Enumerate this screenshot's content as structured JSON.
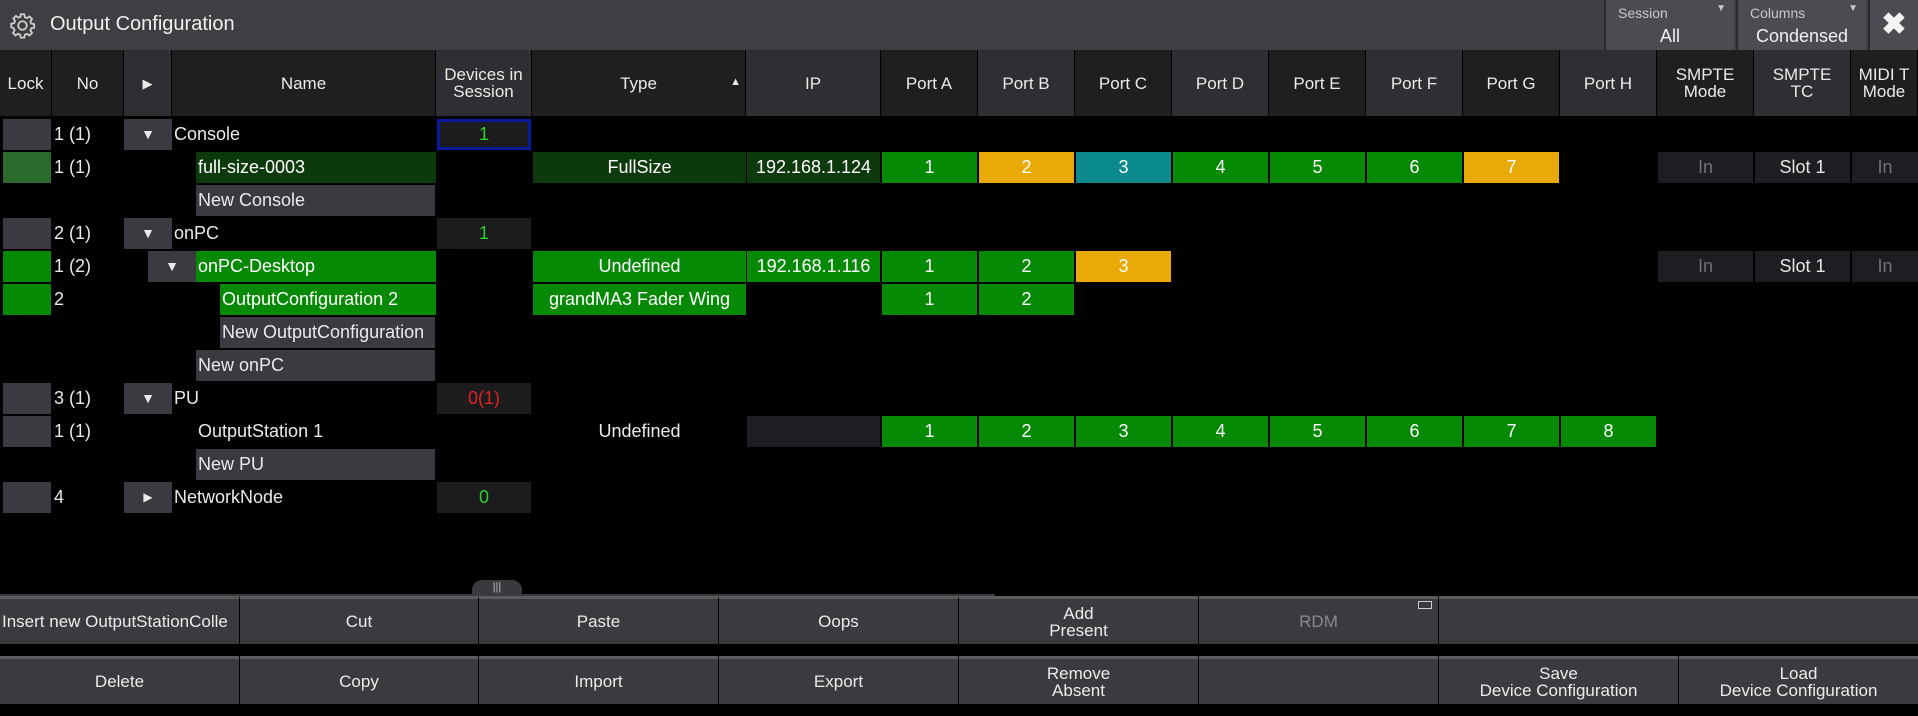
{
  "window": {
    "title": "Output Configuration"
  },
  "session": {
    "label": "Session",
    "value": "All"
  },
  "columns_dd": {
    "label": "Columns",
    "value": "Condensed"
  },
  "headers": {
    "lock": "Lock",
    "no": "No",
    "expand": "▶",
    "name": "Name",
    "devices": "Devices in\nSession",
    "type": "Type",
    "type_sort": "▲",
    "ip": "IP",
    "port_a": "Port A",
    "port_b": "Port B",
    "port_c": "Port C",
    "port_d": "Port D",
    "port_e": "Port E",
    "port_f": "Port F",
    "port_g": "Port G",
    "port_h": "Port H",
    "smpte_mode": "SMPTE\nMode",
    "smpte_tc": "SMPTE\nTC",
    "midi": "MIDI T\nMode"
  },
  "rows": {
    "r0": {
      "no": "1 (1)",
      "tri": "▼",
      "name": "Console",
      "devices": "1"
    },
    "r1": {
      "no": "1 (1)",
      "name": "full-size-0003",
      "type": "FullSize",
      "ip": "192.168.1.124",
      "ports": [
        "1",
        "2",
        "3",
        "4",
        "5",
        "6",
        "7"
      ],
      "smpte_mode": "In",
      "smpte_tc": "Slot 1",
      "midi": "In"
    },
    "r2": {
      "name": "New Console"
    },
    "r3": {
      "no": "2 (1)",
      "tri": "▼",
      "name": "onPC",
      "devices": "1"
    },
    "r4": {
      "no": "1 (2)",
      "tri": "▼",
      "name": "onPC-Desktop",
      "type": "Undefined",
      "ip": "192.168.1.116",
      "ports": [
        "1",
        "2",
        "3"
      ],
      "smpte_mode": "In",
      "smpte_tc": "Slot 1",
      "midi": "In"
    },
    "r5": {
      "no": "2",
      "name": "OutputConfiguration 2",
      "type": "grandMA3 Fader Wing",
      "ports": [
        "1",
        "2"
      ]
    },
    "r6": {
      "name": "New OutputConfiguration"
    },
    "r7": {
      "name": "New onPC"
    },
    "r8": {
      "no": "3 (1)",
      "tri": "▼",
      "name": "PU",
      "devices": "0(1)"
    },
    "r9": {
      "no": "1 (1)",
      "name": "OutputStation 1",
      "type": "Undefined",
      "ports": [
        "1",
        "2",
        "3",
        "4",
        "5",
        "6",
        "7",
        "8"
      ]
    },
    "r10": {
      "name": "New PU"
    },
    "r11": {
      "no": "4",
      "tri": "▶",
      "name": "NetworkNode",
      "devices": "0"
    }
  },
  "buttons": {
    "insert": "Insert new OutputStationColle",
    "cut": "Cut",
    "paste": "Paste",
    "oops": "Oops",
    "add_present": "Add\nPresent",
    "rdm": "RDM",
    "delete": "Delete",
    "copy": "Copy",
    "import": "Import",
    "export": "Export",
    "remove_absent": "Remove\nAbsent",
    "save_config": "Save\nDevice Configuration",
    "load_config": "Load\nDevice Configuration"
  },
  "colors": {
    "green": "#068a06",
    "orange": "#e9a906",
    "teal": "#0a8a8c",
    "count_green": "#2ad22a",
    "count_red": "#e02222",
    "selected_border": "#0a1a9c"
  },
  "icons": {
    "title": "gear-icon",
    "close": "close-icon",
    "expand": "triangle-icon"
  }
}
